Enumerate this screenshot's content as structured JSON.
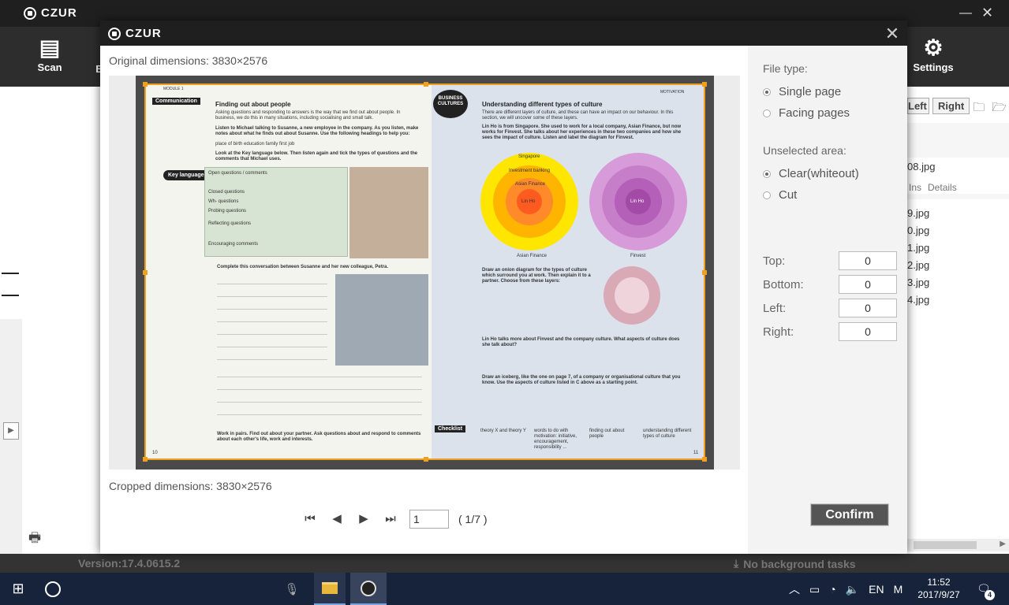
{
  "app": {
    "brand": "CZUR",
    "toolbar": {
      "scan_label": "Scan",
      "b_label": "B",
      "settings_label": "Settings"
    },
    "right_panel": {
      "tab_left": "Left",
      "tab_right": "Right",
      "selected_file": "08.jpg",
      "columns": [
        "Ins",
        "Details"
      ],
      "files": [
        "9.jpg",
        "0.jpg",
        "1.jpg",
        "2.jpg",
        "3.jpg",
        "4.jpg"
      ]
    },
    "status": {
      "version": "Version:17.4.0615.2",
      "background_tasks": "No background tasks"
    }
  },
  "dialog": {
    "brand": "CZUR",
    "original_dimensions": "Original dimensions: 3830×2576",
    "cropped_dimensions": "Cropped dimensions: 3830×2576",
    "pager": {
      "current_page": "1",
      "total": "( 1/7 )"
    },
    "book": {
      "left": {
        "module": "MODULE 1",
        "tag": "Communication",
        "heading": "Finding out about people",
        "intro": "Asking questions and responding to answers is the way that we find out about people. In business, we do this in many situations, including socialising and small talk.",
        "task_a": "Listen to Michael talking to Susanne, a new employee in the company. As you listen, make notes about what he finds out about Susanne. Use the following headings to help you:",
        "headings": "place of birth    education    family    first job",
        "task_b": "Look at the Key language below. Then listen again and tick the types of questions and the comments that Michael uses.",
        "key_language": "Key language",
        "table_rows": [
          "Open questions / comments",
          "Closed questions",
          "Wh- questions",
          "Probing questions",
          "Reflecting questions",
          "Encouraging comments"
        ],
        "task_c": "Complete this conversation between Susanne and her new colleague, Petra.",
        "task_d": "Work in pairs. Find out about your partner. Ask questions about and respond to comments about each other's life, work and interests.",
        "page_number": "10"
      },
      "right": {
        "label": "MOTIVATION",
        "badge": "BUSINESS CULTURES",
        "heading": "Understanding different types of culture",
        "intro": "There are different layers of culture, and these can have an impact on our behaviour. In this section, we will uncover some of these layers.",
        "task_a": "Lin Ho is from Singapore. She used to work for a local company, Asian Finance, but now works for Finvest. She talks about her experiences in these two companies and how she sees the impact of culture. Listen and label the diagram for Finvest.",
        "onion_left_labels": [
          "Singapore",
          "Investment banking",
          "Asian Finance",
          "Lin Ho"
        ],
        "onion_left_caption": "Asian Finance",
        "onion_right_center": "Lin Ho",
        "onion_right_caption": "Finvest",
        "task_b": "Draw an onion diagram for the types of culture which surround you at work. Then explain it to a partner. Choose from these layers:",
        "task_c": "Lin Ho talks more about Finvest and the company culture. What aspects of culture does she talk about?",
        "task_d": "Draw an iceberg, like the one on page 7, of a company or organisational culture that you know. Use the aspects of culture listed in C above as a starting point.",
        "checklist": "Checklist",
        "checklist_items": [
          "theory X and theory Y",
          "words to do with motivation: initiative, encouragement, responsibility ...",
          "finding out about people",
          "understanding different types of culture"
        ],
        "page_number": "11"
      }
    },
    "options": {
      "file_type_label": "File type:",
      "file_types": [
        {
          "label": "Single page",
          "selected": true
        },
        {
          "label": "Facing pages",
          "selected": false
        }
      ],
      "unselected_label": "Unselected area:",
      "unselected_options": [
        {
          "label": "Clear(whiteout)",
          "selected": true
        },
        {
          "label": "Cut",
          "selected": false
        }
      ],
      "margins": [
        {
          "label": "Top:",
          "value": "0"
        },
        {
          "label": "Bottom:",
          "value": "0"
        },
        {
          "label": "Left:",
          "value": "0"
        },
        {
          "label": "Right:",
          "value": "0"
        }
      ],
      "confirm_label": "Confirm"
    }
  },
  "taskbar": {
    "language": "EN",
    "ime": "M",
    "time": "11:52",
    "date": "2017/9/27",
    "notifications": "4"
  },
  "colors": {
    "crop_frame": "#f0a020",
    "titlebar": "#1f1f1f",
    "toolbar": "#2d2d2d",
    "taskbar": "#17233b",
    "confirm": "#555555"
  }
}
